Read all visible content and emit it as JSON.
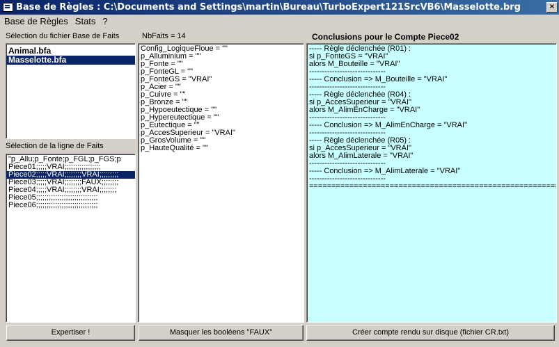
{
  "window": {
    "title": "Base de Règles : C:\\Documents and Settings\\martin\\Bureau\\TurboExpert121SrcVB6\\Masselotte.brg",
    "close_label": "×"
  },
  "menu": [
    "Base de Règles",
    "Stats",
    "?"
  ],
  "labels": {
    "files_header": "Sélection du fichier Base de Faits",
    "nbfaits": "NbFaits = 14",
    "conclusions_header": "Conclusions pour le Compte Piece02",
    "lines_header": "Sélection de la ligne de Faits"
  },
  "files": [
    "Animal.bfa",
    "Masselotte.bfa"
  ],
  "fact_lines": [
    "\"p_Allu;p_Fonte;p_FGL;p_FGS;p",
    "Piece01;;;;;VRAI;;;;;;;;;;;;;;;;;",
    "Piece02;;;;;VRAI;;;;;;;;VRAI;;;;;;;;;",
    "Piece03;;;;;VRAI;;;;;;;;FAUX;;;;;;;;",
    "Piece04;;;;;VRAI;;;;;;;;VRAI;;;;;;;;",
    "Piece05;;;;;;;;;;;;;;;;;;;;;;;;;;;;;",
    "Piece06;;;;;;;;;;;;;;;;;;;;;;;;;;;;;"
  ],
  "facts": [
    "Config_LogiqueFloue = \"\"",
    "p_Alluminium = \"\"",
    "p_Fonte = \"\"",
    "p_FonteGL = \"\"",
    "p_FonteGS = \"VRAI\"",
    "p_Acier = \"\"",
    "p_Cuivre = \"\"",
    "p_Bronze = \"\"",
    "p_Hypoeutectique = \"\"",
    "p_Hypereutectique = \"\"",
    "p_Eutectique = \"\"",
    "p_AccesSuperieur = \"VRAI\"",
    "p_GrosVolume = \"\"",
    "p_HauteQualité = \"\""
  ],
  "conclusions": [
    "----- Règle déclenchée (R01) :",
    "si p_FonteGS = \"VRAI\"",
    "alors M_Bouteille = \"VRAI\"",
    "------------------------------",
    "----- Conclusion => M_Bouteille = \"VRAI\"",
    "------------------------------",
    "----- Règle déclenchée (R04) :",
    "si p_AccesSuperieur = \"VRAI\"",
    "alors M_AlimEnCharge = \"VRAI\"",
    "------------------------------",
    "----- Conclusion => M_AlimEnCharge = \"VRAI\"",
    "------------------------------",
    "----- Règle déclenchée (R05) :",
    "si p_AccesSuperieur = \"VRAI\"",
    "alors M_AlimLaterale = \"VRAI\"",
    "------------------------------",
    "----- Conclusion => M_AlimLaterale = \"VRAI\"",
    "------------------------------",
    "================================================================"
  ],
  "buttons": {
    "expertiser": "Expertiser !",
    "masquer": "Masquer les booléens \"FAUX\"",
    "creer": "Créer compte rendu sur disque (fichier CR.txt)"
  },
  "selection": {
    "file_index": 1,
    "line_index": 2
  }
}
